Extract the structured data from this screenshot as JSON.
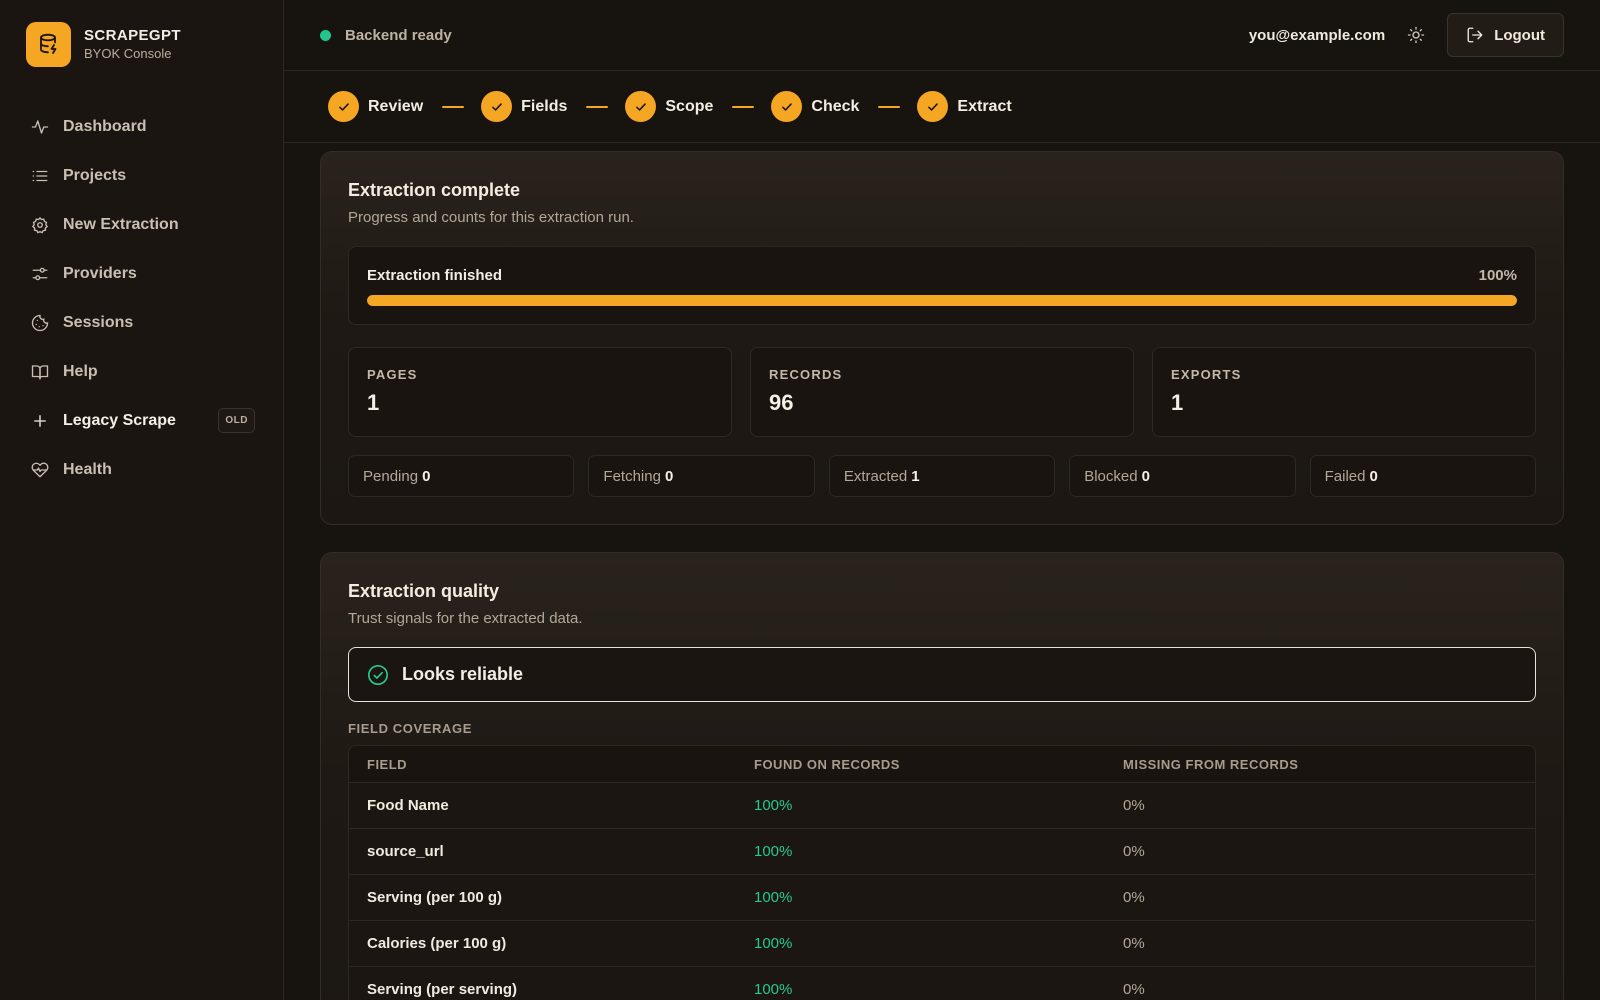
{
  "brand": {
    "name": "SCRAPEGPT",
    "subtitle": "BYOK Console"
  },
  "sidebar": {
    "items": [
      {
        "label": "Dashboard",
        "icon": "activity-icon"
      },
      {
        "label": "Projects",
        "icon": "list-icon"
      },
      {
        "label": "New Extraction",
        "icon": "gear-icon"
      },
      {
        "label": "Providers",
        "icon": "sliders-icon"
      },
      {
        "label": "Sessions",
        "icon": "cookie-icon"
      },
      {
        "label": "Help",
        "icon": "book-icon"
      },
      {
        "label": "Legacy Scrape",
        "icon": "plus-icon",
        "badge": "OLD"
      },
      {
        "label": "Health",
        "icon": "heart-pulse-icon"
      }
    ]
  },
  "topbar": {
    "status": "Backend ready",
    "status_color": "#22c58b",
    "user_email": "you@example.com",
    "logout_label": "Logout"
  },
  "stepper": {
    "steps": [
      "Review",
      "Fields",
      "Scope",
      "Check",
      "Extract"
    ]
  },
  "extraction": {
    "title": "Extraction complete",
    "subtitle": "Progress and counts for this extraction run.",
    "progress_label": "Extraction finished",
    "progress_pct": "100%",
    "progress_value": 1.0,
    "stats": [
      {
        "label": "PAGES",
        "value": "1"
      },
      {
        "label": "RECORDS",
        "value": "96"
      },
      {
        "label": "EXPORTS",
        "value": "1"
      }
    ],
    "counts": [
      {
        "label": "Pending",
        "value": "0"
      },
      {
        "label": "Fetching",
        "value": "0"
      },
      {
        "label": "Extracted",
        "value": "1"
      },
      {
        "label": "Blocked",
        "value": "0"
      },
      {
        "label": "Failed",
        "value": "0"
      }
    ]
  },
  "quality": {
    "title": "Extraction quality",
    "subtitle": "Trust signals for the extracted data.",
    "verdict": "Looks reliable",
    "section_label": "FIELD COVERAGE",
    "columns": [
      "FIELD",
      "FOUND ON RECORDS",
      "MISSING FROM RECORDS"
    ],
    "rows": [
      {
        "field": "Food Name",
        "found": "100%",
        "missing": "0%"
      },
      {
        "field": "source_url",
        "found": "100%",
        "missing": "0%"
      },
      {
        "field": "Serving (per 100 g)",
        "found": "100%",
        "missing": "0%"
      },
      {
        "field": "Calories (per 100 g)",
        "found": "100%",
        "missing": "0%"
      },
      {
        "field": "Serving (per serving)",
        "found": "100%",
        "missing": "0%"
      }
    ]
  },
  "colors": {
    "accent": "#f5a623",
    "success": "#28c88e"
  }
}
